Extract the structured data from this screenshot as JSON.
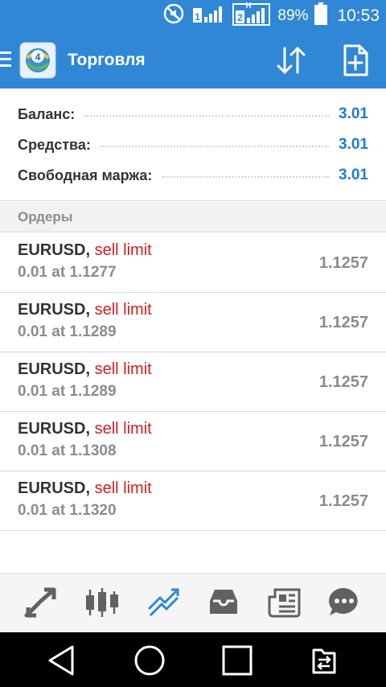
{
  "status_bar": {
    "battery": "89%",
    "time": "10:53",
    "icons": [
      "mute-icon",
      "signal-sim1-icon",
      "signal-sim2-icon",
      "battery-icon"
    ]
  },
  "app_bar": {
    "title": "Торговля",
    "icons": [
      "menu-icon",
      "metatrader-logo",
      "sort-icon",
      "new-order-icon"
    ]
  },
  "account": {
    "rows": [
      {
        "label": "Баланс:",
        "value": "3.01"
      },
      {
        "label": "Средства:",
        "value": "3.01"
      },
      {
        "label": "Свободная маржа:",
        "value": "3.01"
      }
    ]
  },
  "orders_header": "Ордеры",
  "orders": [
    {
      "symbol": "EURUSD,",
      "type": "sell limit",
      "details": "0.01 at 1.1277",
      "price": "1.1257"
    },
    {
      "symbol": "EURUSD,",
      "type": "sell limit",
      "details": "0.01 at 1.1289",
      "price": "1.1257"
    },
    {
      "symbol": "EURUSD,",
      "type": "sell limit",
      "details": "0.01 at 1.1289",
      "price": "1.1257"
    },
    {
      "symbol": "EURUSD,",
      "type": "sell limit",
      "details": "0.01 at 1.1308",
      "price": "1.1257"
    },
    {
      "symbol": "EURUSD,",
      "type": "sell limit",
      "details": "0.01 at 1.1320",
      "price": "1.1257"
    }
  ],
  "bottom_nav": {
    "items": [
      "quotes-icon",
      "chart-icon",
      "trade-icon",
      "history-icon",
      "news-icon",
      "chat-icon"
    ],
    "active": "trade-icon"
  },
  "colors": {
    "primary": "#2f87d6",
    "value_blue": "#1f7bd6",
    "sell_red": "#d21f1f",
    "muted": "#8c8c8c"
  }
}
